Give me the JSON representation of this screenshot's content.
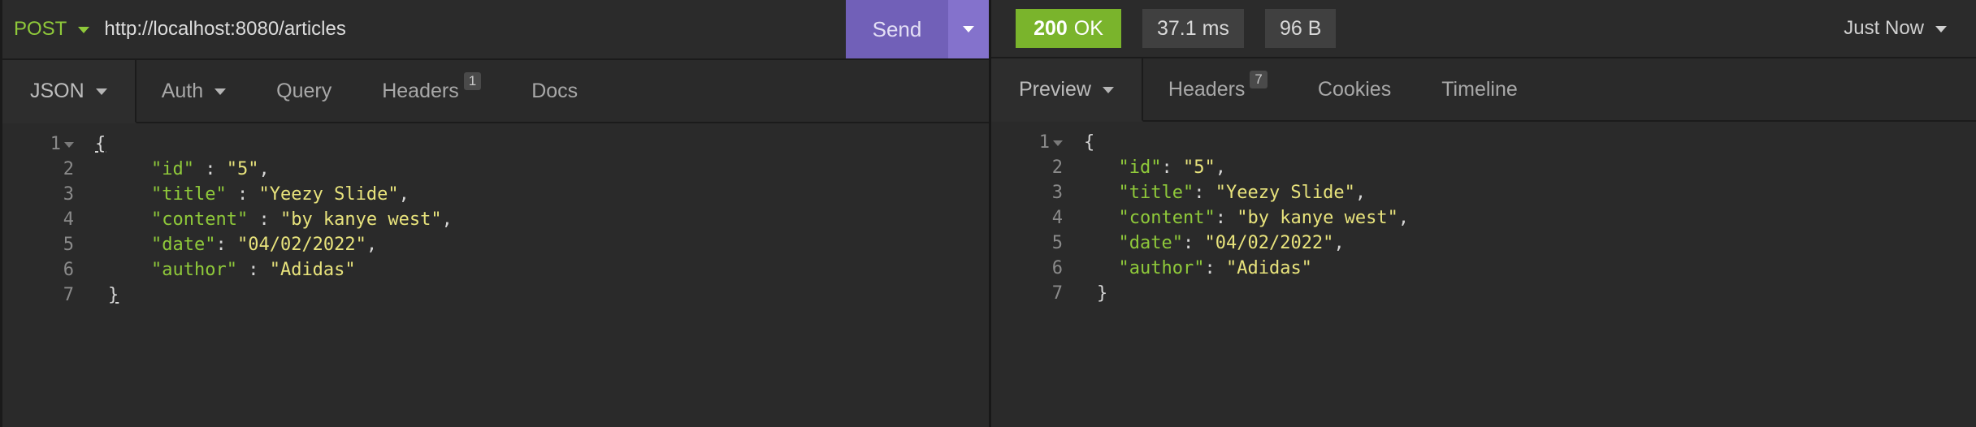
{
  "request": {
    "method": "POST",
    "url": "http://localhost:8080/articles",
    "send_label": "Send",
    "tabs": [
      {
        "label": "JSON"
      },
      {
        "label": "Auth"
      },
      {
        "label": "Query"
      },
      {
        "label": "Headers",
        "count": "1"
      },
      {
        "label": "Docs"
      }
    ],
    "body_lines": [
      {
        "n": "1",
        "open": "{"
      },
      {
        "n": "2",
        "key": "\"id\"",
        "sep": " : ",
        "val": "\"5\"",
        "end": ","
      },
      {
        "n": "3",
        "key": "\"title\"",
        "sep": " : ",
        "val": "\"Yeezy Slide\"",
        "end": ","
      },
      {
        "n": "4",
        "key": "\"content\"",
        "sep": " : ",
        "val": "\"by kanye west\"",
        "end": ","
      },
      {
        "n": "5",
        "key": "\"date\"",
        "sep": ": ",
        "val": "\"04/02/2022\"",
        "end": ","
      },
      {
        "n": "6",
        "key": "\"author\"",
        "sep": " : ",
        "val": "\"Adidas\"",
        "end": ""
      },
      {
        "n": "7",
        "open": "}"
      }
    ]
  },
  "response": {
    "status_code": "200",
    "status_text": "OK",
    "time": "37.1 ms",
    "size": "96 B",
    "timestamp": "Just Now",
    "tabs": [
      {
        "label": "Preview"
      },
      {
        "label": "Headers",
        "count": "7"
      },
      {
        "label": "Cookies"
      },
      {
        "label": "Timeline"
      }
    ],
    "body_lines": [
      {
        "n": "1",
        "open": "{"
      },
      {
        "n": "2",
        "key": "\"id\"",
        "sep": ": ",
        "val": "\"5\"",
        "end": ","
      },
      {
        "n": "3",
        "key": "\"title\"",
        "sep": ": ",
        "val": "\"Yeezy Slide\"",
        "end": ","
      },
      {
        "n": "4",
        "key": "\"content\"",
        "sep": ": ",
        "val": "\"by kanye west\"",
        "end": ","
      },
      {
        "n": "5",
        "key": "\"date\"",
        "sep": ": ",
        "val": "\"04/02/2022\"",
        "end": ","
      },
      {
        "n": "6",
        "key": "\"author\"",
        "sep": ": ",
        "val": "\"Adidas\"",
        "end": ""
      },
      {
        "n": "7",
        "open": "}"
      }
    ]
  },
  "colors": {
    "method": "#8fc93a",
    "send": "#7160b8",
    "status_ok": "#7ab42c",
    "json_key": "#8fc93a",
    "json_string": "#e8e37c"
  }
}
